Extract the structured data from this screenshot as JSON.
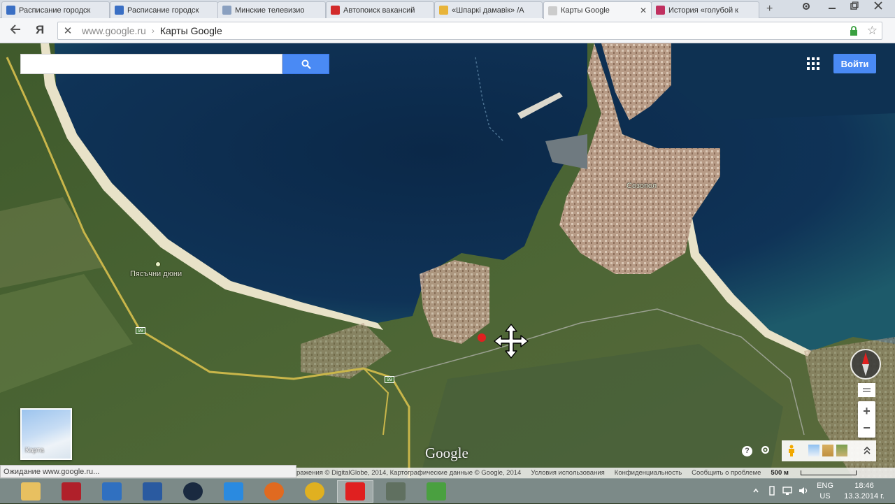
{
  "browser": {
    "tabs": [
      {
        "title": "Расписание городск",
        "favicon_color": "#3a6fc4",
        "active": false
      },
      {
        "title": "Расписание городск",
        "favicon_color": "#3a6fc4",
        "active": false
      },
      {
        "title": "Минские телевизио",
        "favicon_color": "#8aa0c0",
        "active": false
      },
      {
        "title": "Автопоиск вакансий",
        "favicon_color": "#d22a2a",
        "active": false
      },
      {
        "title": "«Шпаркі дамавік» /А",
        "favicon_color": "#e8b43a",
        "active": false
      },
      {
        "title": "Карты Google",
        "favicon_color": "#cccccc",
        "active": true
      },
      {
        "title": "История «голубой к",
        "favicon_color": "#c03060",
        "active": false
      }
    ],
    "new_tab_label": "+",
    "address": {
      "host": "www.google.ru",
      "separator": "›",
      "page_title": "Карты Google"
    }
  },
  "maps": {
    "search_placeholder": "",
    "signin_label": "Войти",
    "place_labels": {
      "town": "Созопол",
      "dunes": "Пясъчни дюни"
    },
    "road_shields": [
      "99",
      "99"
    ],
    "minimap_label": "Карта",
    "logo": "Google",
    "copyright": "ражения © DigitalGlobe, 2014, Картографические данные © Google, 2014",
    "terms": "Условия использования",
    "privacy": "Конфиденциальность",
    "report": "Сообщить о проблеме",
    "scale_label": "500 м",
    "help_label": "?",
    "colors": {
      "accent": "#4a8af4",
      "pin": "#e02020",
      "sea": "#0f2d4f"
    }
  },
  "status_bar": {
    "text": "Ожидание www.google.ru..."
  },
  "taskbar": {
    "apps": [
      {
        "icon": "folder-icon",
        "color": "#e8c060"
      },
      {
        "icon": "pdf-reader-icon",
        "color": "#b0202a"
      },
      {
        "icon": "monitor-app-icon",
        "color": "#3070c0"
      },
      {
        "icon": "network-app-icon",
        "color": "#2a5aa0"
      },
      {
        "icon": "globe-app-icon",
        "color": "#1a2a40"
      },
      {
        "icon": "ie-icon",
        "color": "#2a8ae0"
      },
      {
        "icon": "firefox-icon",
        "color": "#e06a20"
      },
      {
        "icon": "chrome-icon",
        "color": "#e0b020"
      },
      {
        "icon": "yandex-browser-icon",
        "color": "#e02020"
      },
      {
        "icon": "media-app-icon",
        "color": "#607060"
      },
      {
        "icon": "utorrent-icon",
        "color": "#4aa040"
      }
    ],
    "lang_top": "ENG",
    "lang_bottom": "US",
    "time": "18:46",
    "date": "13.3.2014 г."
  }
}
